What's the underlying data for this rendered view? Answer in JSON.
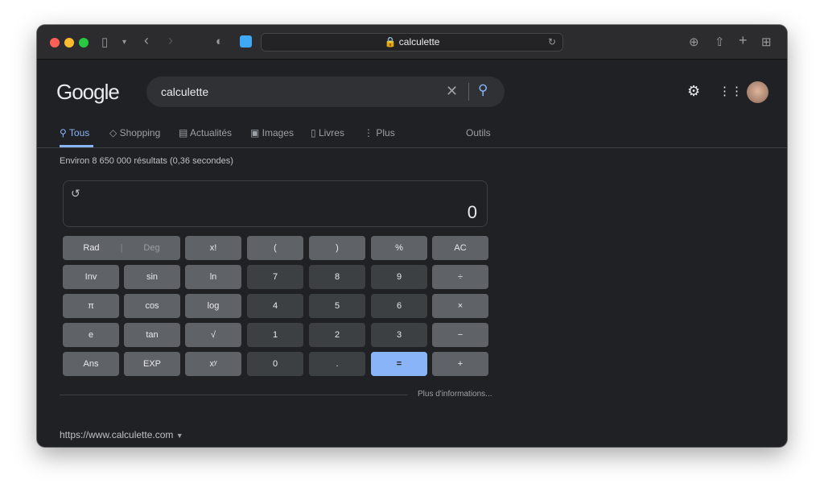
{
  "browser": {
    "url": "calculette"
  },
  "google": {
    "logo": "Google",
    "query": "calculette"
  },
  "tabs": [
    {
      "label": "Tous",
      "active": true
    },
    {
      "label": "Shopping"
    },
    {
      "label": "Actualités"
    },
    {
      "label": "Images"
    },
    {
      "label": "Livres"
    },
    {
      "label": "Plus"
    }
  ],
  "tools": "Outils",
  "stats": "Environ 8 650 000 résultats (0,36 secondes)",
  "calc": {
    "display": "0",
    "rad": "Rad",
    "deg": "Deg",
    "rows": [
      [
        "x!",
        "(",
        ")",
        "%",
        "AC"
      ],
      [
        "Inv",
        "sin",
        "ln",
        "7",
        "8",
        "9",
        "÷"
      ],
      [
        "π",
        "cos",
        "log",
        "4",
        "5",
        "6",
        "×"
      ],
      [
        "e",
        "tan",
        "√",
        "1",
        "2",
        "3",
        "−"
      ],
      [
        "Ans",
        "EXP",
        "xʸ",
        "0",
        ".",
        "=",
        "+"
      ]
    ],
    "more": "Plus d'informations..."
  },
  "result_url": "https://www.calculette.com",
  "colors": {
    "accent": "#8ab4f8",
    "bg": "#202124"
  }
}
